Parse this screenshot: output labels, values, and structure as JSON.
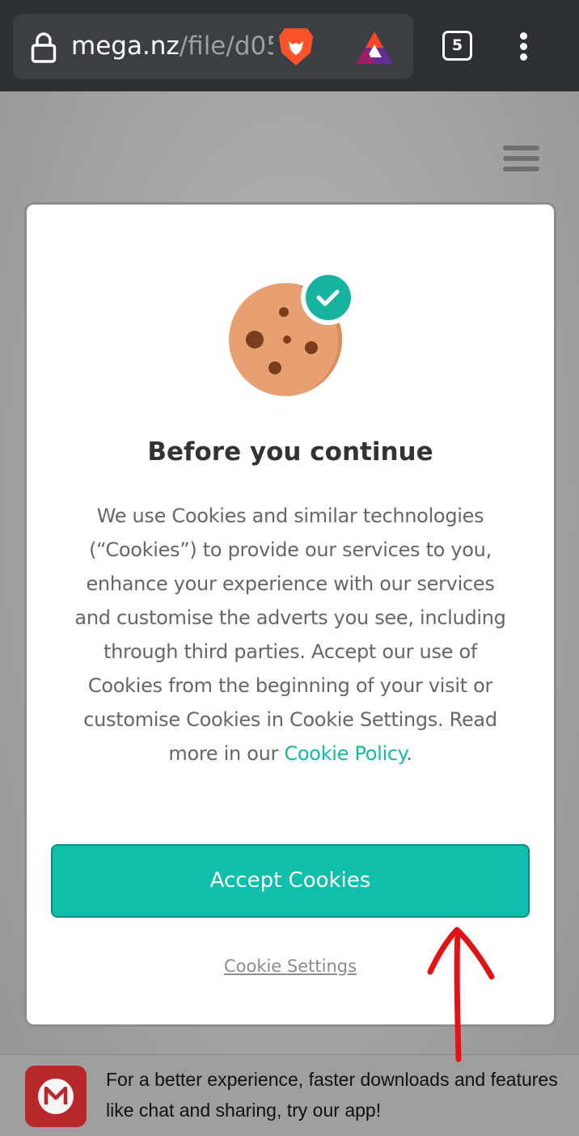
{
  "browser": {
    "url_host": "mega.nz",
    "url_path": "/file/d05",
    "tab_count": "5",
    "icons": [
      "lock-icon",
      "brave-lion-icon",
      "bat-rewards-icon",
      "tab-switcher-icon",
      "more-menu-icon"
    ]
  },
  "page": {
    "menu_icon": "hamburger-menu-icon"
  },
  "modal": {
    "title": "Before you continue",
    "body": "We use Cookies and similar technologies (“Cookies”) to provide our services to you, enhance your experience with our services and customise the adverts you see, including through third parties. Accept our use of Cookies from the beginning of your visit or customise Cookies in Cookie Settings. Read more in our ",
    "policy_link": "Cookie Policy",
    "body_end": ".",
    "accept_label": "Accept Cookies",
    "settings_label": "Cookie Settings",
    "accent_color": "#0fbfac"
  },
  "app_banner": {
    "text": "For a better experience, faster downloads and features like chat and sharing, try our app!",
    "logo_color": "#b8282b"
  }
}
